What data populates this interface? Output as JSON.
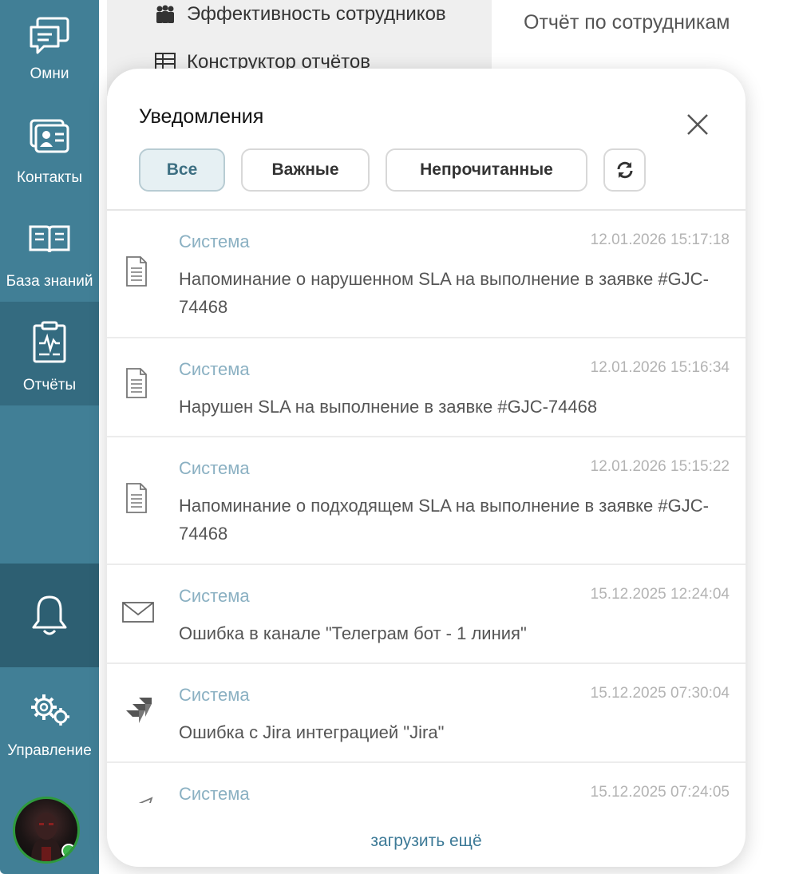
{
  "sidebar": {
    "items": [
      {
        "label": "Омни",
        "icon": "chat-icon"
      },
      {
        "label": "Контакты",
        "icon": "contact-card-icon"
      },
      {
        "label": "База знаний",
        "icon": "book-icon"
      },
      {
        "label": "Отчёты",
        "icon": "report-icon"
      },
      {
        "label": "Управление",
        "icon": "gears-icon"
      }
    ],
    "bell_icon": "bell-icon",
    "status": "online"
  },
  "reports_menu": {
    "items": [
      {
        "label": "Эффективность сотрудников",
        "icon": "team-icon"
      },
      {
        "label": "Конструктор отчётов",
        "icon": "report-builder-icon"
      }
    ]
  },
  "report_title": "Отчёт по сотрудникам",
  "notifications": {
    "title": "Уведомления",
    "filters": [
      {
        "label": "Все",
        "active": true
      },
      {
        "label": "Важные",
        "active": false
      },
      {
        "label": "Непрочитанные",
        "active": false
      }
    ],
    "refresh_icon": "refresh-icon",
    "close_icon": "close-icon",
    "items": [
      {
        "sender": "Система",
        "time": "12.01.2026 15:17:18",
        "text": "Напоминание о нарушенном SLA на выполнение в заявке #GJC-74468",
        "icon": "document-icon"
      },
      {
        "sender": "Система",
        "time": "12.01.2026 15:16:34",
        "text": "Нарушен SLA на выполнение в заявке #GJC-74468",
        "icon": "document-icon"
      },
      {
        "sender": "Система",
        "time": "12.01.2026 15:15:22",
        "text": "Напоминание о подходящем SLA на выполнение в заявке #GJC-74468",
        "icon": "document-icon"
      },
      {
        "sender": "Система",
        "time": "15.12.2025 12:24:04",
        "text": "Ошибка в канале \"Телеграм бот - 1 линия\"",
        "icon": "envelope-icon"
      },
      {
        "sender": "Система",
        "time": "15.12.2025 07:30:04",
        "text": "Ошибка с Jira интеграцией \"Jira\"",
        "icon": "jira-icon"
      },
      {
        "sender": "Система",
        "time": "15.12.2025 07:24:05",
        "text": "",
        "icon": "telegram-icon"
      }
    ],
    "load_more": "загрузить ещё"
  },
  "colors": {
    "sidebar": "#417f96",
    "sidebar_active": "#346b80",
    "accent": "#3d7a97",
    "sender": "#8ab0c2"
  }
}
